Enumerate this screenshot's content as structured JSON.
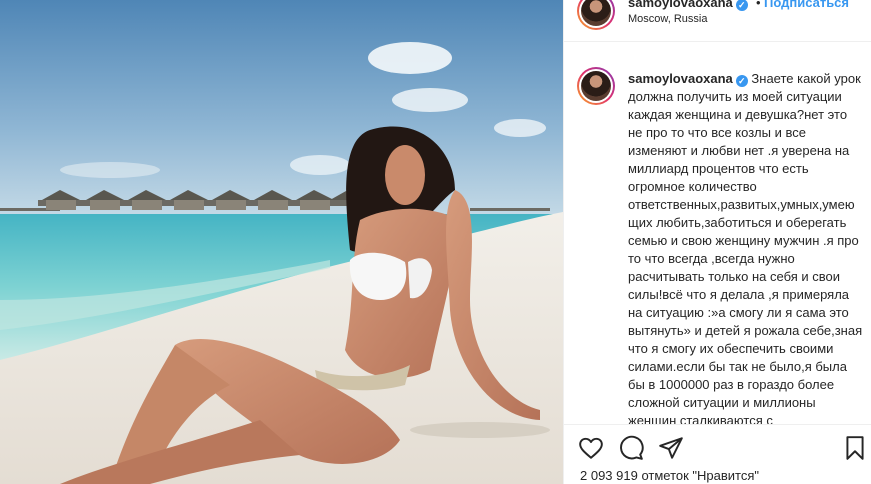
{
  "post": {
    "author": {
      "username": "samoylovaoxana",
      "verified_icon": "verified-badge-icon",
      "location": "Moscow, Russia"
    },
    "follow_label": "Подписаться",
    "separator": "•",
    "caption": "Знаете какой урок должна получить из моей ситуации каждая женщина и девушка?нет это не про то что все козлы и все изменяют и любви нет .я уверена на миллиард процентов что есть огромное количество ответственных,развитых,умных,умеющих любить,заботиться и оберегать семью и свою женщину мужчин .я про то что всегда ,всегда нужно расчитывать только на себя и свои силы!всё что я делала ,я примеряла на ситуацию :»а смогу ли я сама это вытянуть» и детей я рожала себе,зная что я смогу их обеспечить своими силами.если бы так не было,я была бы в 1000000 раз в гораздо более сложной ситуации и миллионы женщин сталкиваются с",
    "likes_text": "2 093 919 отметок \"Нравится\"",
    "actions": [
      "heart-icon",
      "comment-icon",
      "share-icon",
      "bookmark-icon"
    ]
  },
  "colors": {
    "accent": "#3897f0",
    "text": "#262626",
    "border": "#efefef"
  }
}
